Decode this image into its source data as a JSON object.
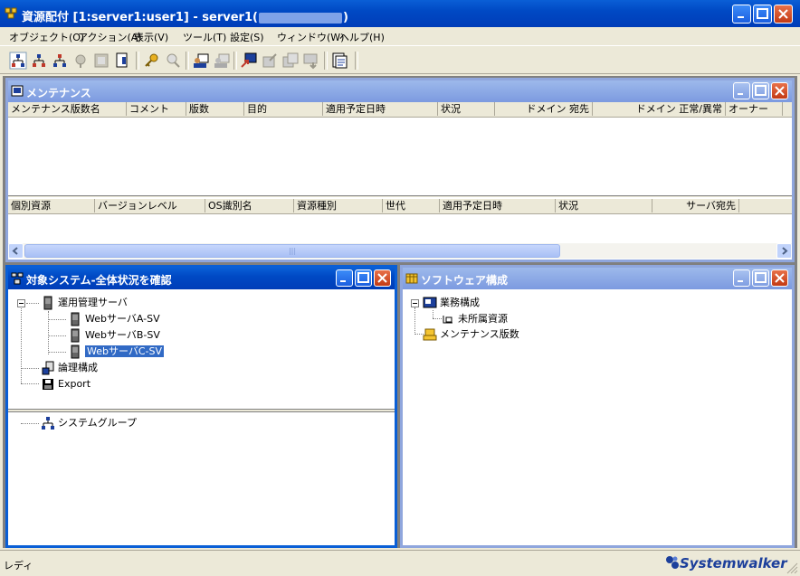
{
  "app": {
    "title_prefix": "資源配付 [1:server1:user1] - server1(",
    "title_suffix": ")"
  },
  "menu": [
    {
      "label": "オブジェクト(O)"
    },
    {
      "label": "アクション(A)"
    },
    {
      "label": "表示(V)"
    },
    {
      "label": "ツール(T)"
    },
    {
      "label": "設定(S)"
    },
    {
      "label": "ウィンドウ(W)"
    },
    {
      "label": "ヘルプ(H)"
    }
  ],
  "toolbar_icons": [
    "network-red-icon",
    "network-red2-icon",
    "network-blue-icon",
    "disabled-icon",
    "disabled2-icon",
    "document-icon",
    "key-icon",
    "disabled-search-icon",
    "user-monitor-icon",
    "disabled-user-icon",
    "arrow-send-icon",
    "disabled-edit-icon",
    "disabled-copy-icon",
    "disabled-dl-icon",
    "report-icon"
  ],
  "maintenance": {
    "title": "メンテナンス",
    "columns_top": [
      "メンテナンス版数名",
      "コメント",
      "版数",
      "目的",
      "適用予定日時",
      "状況",
      "ドメイン 宛先",
      "ドメイン 正常/異常",
      "オーナー"
    ],
    "columns_bottom": [
      "個別資源",
      "バージョンレベル",
      "OS識別名",
      "資源種別",
      "世代",
      "適用予定日時",
      "状況",
      "サーバ宛先"
    ],
    "scroll_grip": "|||"
  },
  "target_system": {
    "title": "対象システム-全体状況を確認",
    "tree": {
      "root": "運用管理サーバ",
      "children": [
        "WebサーバA-SV",
        "WebサーバB-SV",
        "WebサーバC-SV"
      ],
      "logical": "論理構成",
      "export": "Export",
      "group": "システムグループ"
    }
  },
  "software": {
    "title": "ソフトウェア構成",
    "tree": {
      "business": "業務構成",
      "unassigned": "未所属資源",
      "maintenance": "メンテナンス版数"
    }
  },
  "status": {
    "text": "レディ",
    "brand": "Systemwalker"
  },
  "colors": {
    "title_active": "#0A5FD6",
    "title_inactive": "#9DB9EB",
    "selection": "#316AC5",
    "brand": "#1C3F9B"
  }
}
